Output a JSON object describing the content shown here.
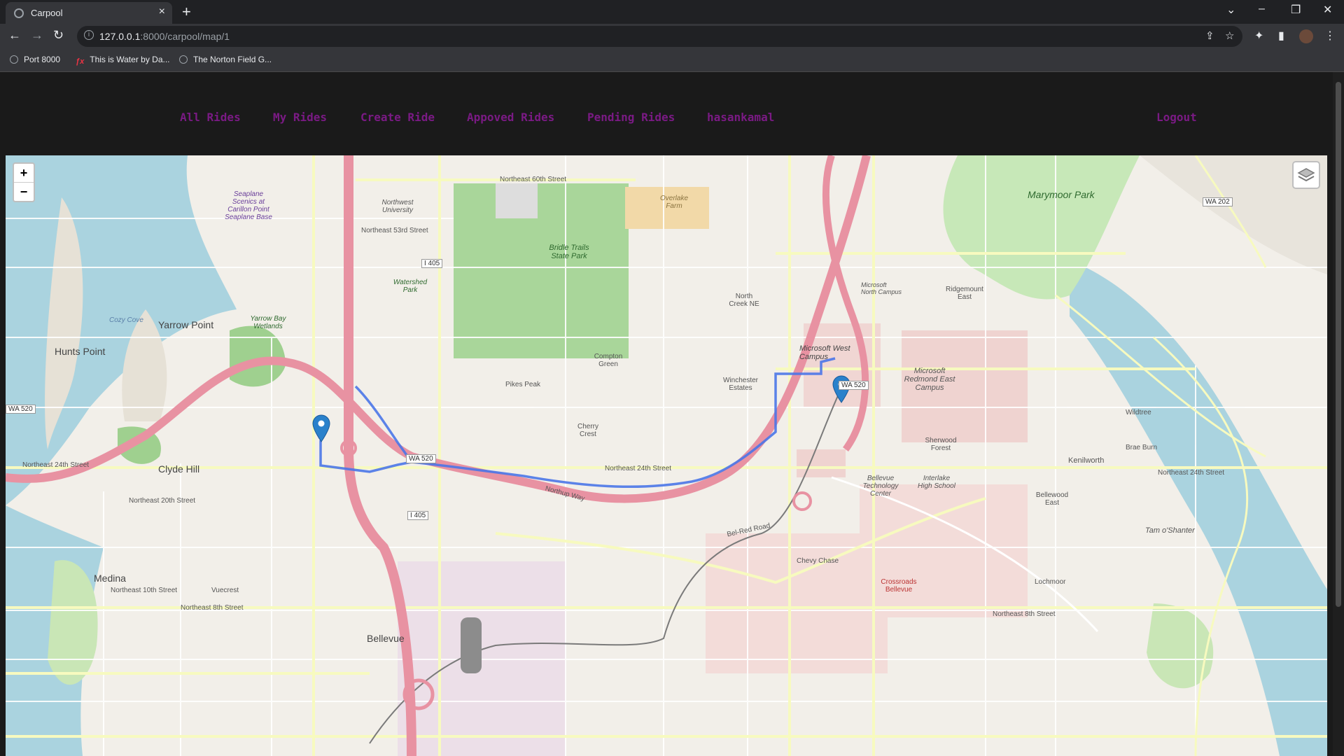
{
  "browser": {
    "tab_title": "Carpool",
    "url_host": "127.0.0.1",
    "url_path": ":8000/carpool/map/1",
    "bookmarks": [
      {
        "label": "Port 8000"
      },
      {
        "label": "This is Water by Da..."
      },
      {
        "label": "The Norton Field G..."
      }
    ]
  },
  "nav": {
    "all_rides": "All Rides",
    "my_rides": "My Rides",
    "create_ride": "Create Ride",
    "approved_rides": "Appoved Rides",
    "pending_rides": "Pending Rides",
    "username": "hasankamal",
    "logout": "Logout"
  },
  "map": {
    "zoom_in": "+",
    "zoom_out": "−",
    "labels": {
      "marymoor_park": "Marymoor Park",
      "bridle_trails": "Bridle Trails State Park",
      "yarrow_point": "Yarrow Point",
      "hunts_point": "Hunts Point",
      "clyde_hill": "Clyde Hill",
      "medina": "Medina",
      "bellevue": "Bellevue",
      "ms_west": "Microsoft West Campus",
      "ms_east": "Microsoft Redmond East Campus",
      "ms_north": "Microsoft North Campus",
      "kenilworth": "Kenilworth",
      "tam_o_shanter": "Tam o'Shanter",
      "ne_24th": "Northeast 24th Street",
      "ne_20th": "Northeast 20th Street",
      "ne_8th": "Northeast 8th Street",
      "ne_10th": "Northeast 10th Street",
      "ne_60th": "Northeast 60th Street",
      "ne_53rd": "Northeast 53rd Street",
      "wa520_a": "WA 520",
      "wa520_b": "WA 520",
      "i405_a": "I 405",
      "i405_b": "I 405",
      "wa202": "WA 202",
      "northwest_university": "Northwest University",
      "seaplane": "Seaplane Scenics at Carillon Point Seaplane Base",
      "overlake_farm": "Overlake Farm",
      "pikes_peak": "Pikes Peak",
      "compton_green": "Compton Green",
      "cherry_crest": "Cherry Crest",
      "winchester": "Winchester Estates",
      "sherwood": "Sherwood Forest",
      "bellevue_tech": "Bellevue Technology Center",
      "interlake": "Interlake High School",
      "crossroads": "Crossroads Bellevue",
      "north_creek": "North Creek NE",
      "ridgemount": "Ridgemount East",
      "cozy_cove": "Cozy Cove",
      "yarrow_bay": "Yarrow Bay Wetlands",
      "watershed": "Watershed Park",
      "bel_red": "Bel-Red Road",
      "northup": "Northup Way",
      "wildtree": "Wildtree",
      "brae_burn": "Brae Burn",
      "lochmoor": "Lochmoor",
      "chevy_chase": "Chevy Chase",
      "vuecrest": "Vuecrest",
      "bellewood": "Bellewood East"
    }
  }
}
